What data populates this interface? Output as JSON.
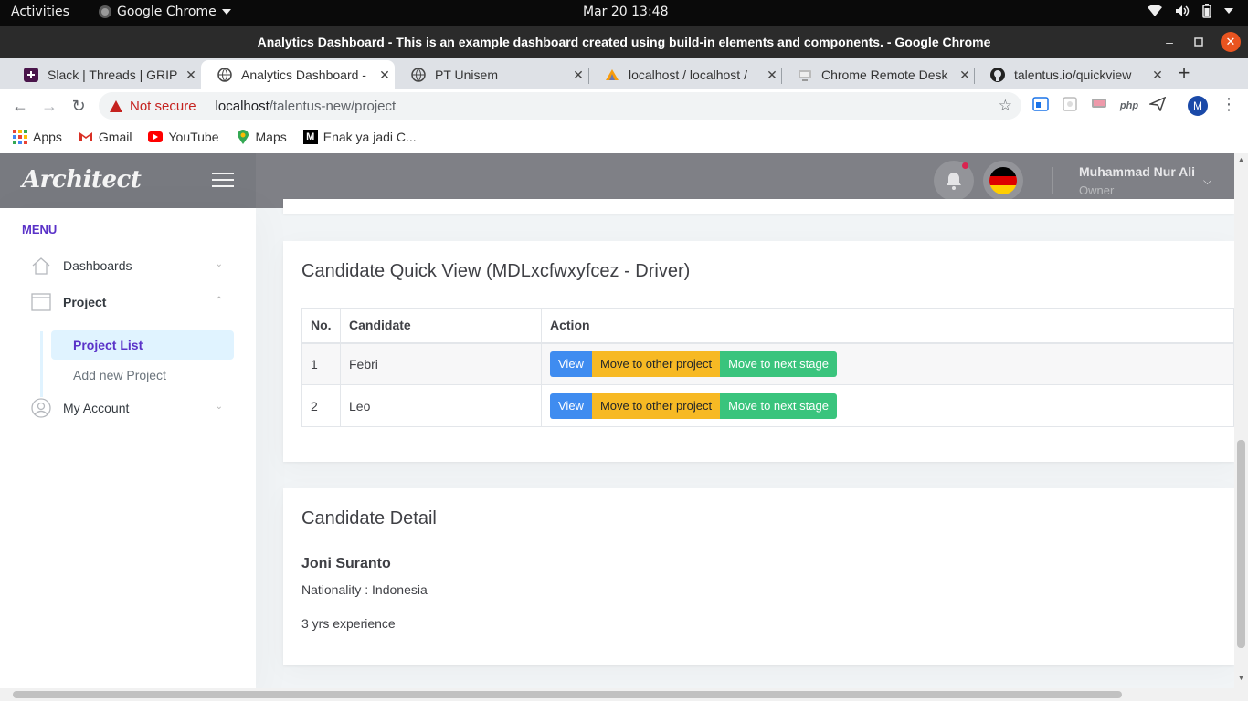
{
  "gnome": {
    "activities": "Activities",
    "app_name": "Google Chrome",
    "clock": "Mar 20  13:48"
  },
  "window": {
    "title": "Analytics Dashboard - This is an example dashboard created using build-in elements and components. - Google Chrome"
  },
  "tabs": [
    {
      "label": "Slack | Threads | GRIP",
      "icon": "slack-icon"
    },
    {
      "label": "Analytics Dashboard -",
      "icon": "globe-icon",
      "active": true
    },
    {
      "label": "PT Unisem",
      "icon": "globe-icon"
    },
    {
      "label": "localhost / localhost /",
      "icon": "phpmyadmin-icon"
    },
    {
      "label": "Chrome Remote Desk",
      "icon": "remote-desktop-icon"
    },
    {
      "label": "talentus.io/quickview",
      "icon": "github-icon"
    }
  ],
  "address": {
    "security": "Not secure",
    "host": "localhost",
    "path": "/talentus-new/project"
  },
  "extensions": [
    "php"
  ],
  "profile_initial": "M",
  "bookmarks": [
    {
      "label": "Apps",
      "icon": "apps-grid-icon"
    },
    {
      "label": "Gmail",
      "icon": "gmail-icon"
    },
    {
      "label": "YouTube",
      "icon": "youtube-icon"
    },
    {
      "label": "Maps",
      "icon": "maps-pin-icon"
    },
    {
      "label": "Enak ya jadi C...",
      "icon": "medium-icon"
    }
  ],
  "app": {
    "logo": "Architect",
    "user": {
      "name": "Muhammad Nur Ali",
      "role": "Owner"
    },
    "colors": {
      "accent": "#5a32c8",
      "view": "#3f8cf0",
      "move": "#f7b924",
      "next": "#3ac47d",
      "notification_dot": "#d92550"
    }
  },
  "sidebar": {
    "heading": "MENU",
    "items": [
      {
        "label": "Dashboards",
        "icon": "home-icon"
      },
      {
        "label": "Project",
        "icon": "browser-window-icon"
      },
      {
        "label": "My Account",
        "icon": "user-circle-icon"
      }
    ],
    "submenu": [
      {
        "label": "Project List",
        "active": true
      },
      {
        "label": "Add new Project"
      }
    ]
  },
  "quick_view": {
    "title": "Candidate Quick View (MDLxcfwxyfcez - Driver)",
    "columns": [
      "No.",
      "Candidate",
      "Action"
    ],
    "rows": [
      {
        "no": "1",
        "candidate": "Febri"
      },
      {
        "no": "2",
        "candidate": "Leo"
      }
    ],
    "actions": {
      "view": "View",
      "move": "Move to other project",
      "next": "Move to next stage"
    }
  },
  "detail": {
    "title": "Candidate Detail",
    "name": "Joni Suranto",
    "nationality": "Nationality : Indonesia",
    "experience": "3 yrs experience"
  }
}
